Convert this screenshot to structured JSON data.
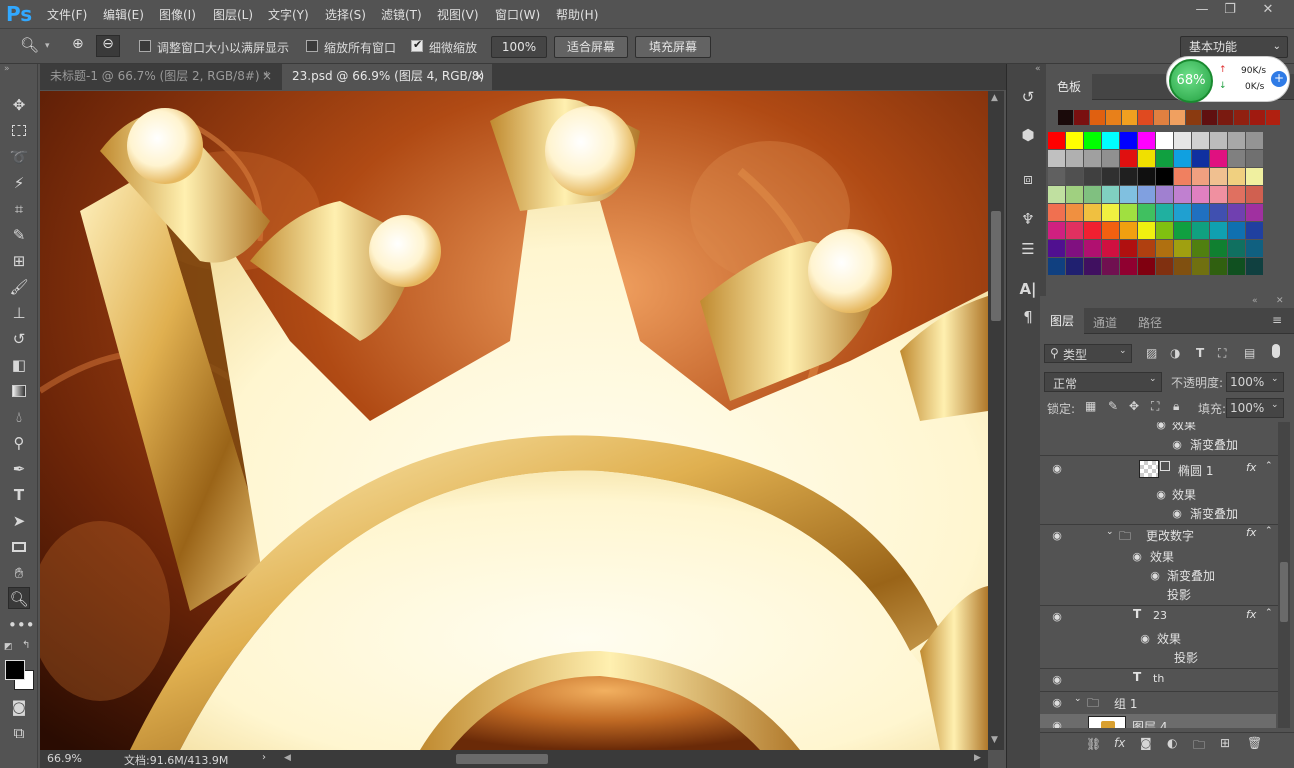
{
  "app": {
    "logo": "Ps"
  },
  "menu": [
    "文件(F)",
    "编辑(E)",
    "图像(I)",
    "图层(L)",
    "文字(Y)",
    "选择(S)",
    "滤镜(T)",
    "视图(V)",
    "窗口(W)",
    "帮助(H)"
  ],
  "options": {
    "resize_window": "调整窗口大小以满屏显示",
    "zoom_all": "缩放所有窗口",
    "scrubby_zoom": "细微缩放",
    "zoom_value": "100%",
    "fit_screen": "适合屏幕",
    "fill_screen": "填充屏幕",
    "workspace": "基本功能"
  },
  "tabs": [
    {
      "label": "未标题-1 @ 66.7% (图层 2, RGB/8#) *",
      "close": "×"
    },
    {
      "label": "23.psd @ 66.9% (图层 4, RGB/8)",
      "close": "×"
    }
  ],
  "netmon": {
    "percent": "68%",
    "up": "90K/s",
    "down": "0K/s"
  },
  "swatches": {
    "title": "色板"
  },
  "layers_panel": {
    "tabs": [
      "图层",
      "通道",
      "路径"
    ],
    "filter": "类型",
    "blend_mode": "正常",
    "opacity_label": "不透明度:",
    "opacity": "100%",
    "lock_label": "锁定:",
    "fill_label": "填充:",
    "fill": "100%",
    "rows": [
      "效果",
      "渐变叠加",
      "椭圆 1",
      "效果",
      "渐变叠加",
      "更改数字",
      "效果",
      "渐变叠加",
      "投影",
      "23",
      "效果",
      "投影",
      "th",
      "组 1",
      "图层 4"
    ]
  },
  "status": {
    "zoom": "66.9%",
    "doc": "文档:91.6M/413.9M"
  }
}
